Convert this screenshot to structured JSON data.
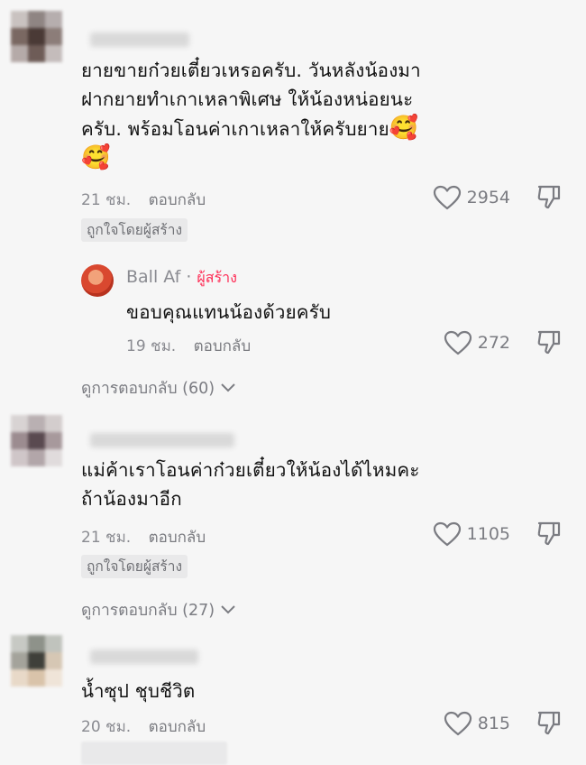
{
  "comments": [
    {
      "text_lines": [
        "ยายขายก๋วยเตี๋ยวเหรอครับ. วันหลังน้องมา",
        "ฝากยายทำเกาเหลาพิเศษ ให้น้องหน่อยนะ",
        "ครับ. พร้อมโอนค่าเกาเหลาให้ครับยาย"
      ],
      "emoji": "🥰",
      "time": "21 ชม.",
      "reply_label": "ตอบกลับ",
      "likes": "2954",
      "badge": "ถูกใจโดยผู้สร้าง",
      "reply": {
        "author": "Ball Af",
        "separator": " · ",
        "creator_label": "ผู้สร้าง",
        "text": "ขอบคุณแทนน้องด้วยครับ",
        "time": "19 ชม.",
        "reply_label": "ตอบกลับ",
        "likes": "272"
      },
      "view_replies": "ดูการตอบกลับ (60)"
    },
    {
      "text_lines": [
        "แม่ค้าเราโอนค่าก๋วยเตี๋ยวให้น้องได้ไหมคะ",
        "ถ้าน้องมาอีก"
      ],
      "time": "21 ชม.",
      "reply_label": "ตอบกลับ",
      "likes": "1105",
      "badge": "ถูกใจโดยผู้สร้าง",
      "view_replies": "ดูการตอบกลับ (27)"
    },
    {
      "text_lines": [
        "น้ำซุป ชุบชีวิต"
      ],
      "time": "20 ชม.",
      "reply_label": "ตอบกลับ",
      "likes": "815"
    }
  ],
  "icons": {
    "like": "heart-outline-icon",
    "dislike": "thumbs-down-icon",
    "expand": "chevron-down-icon"
  },
  "colors": {
    "creator": "#fe2c55",
    "secondary_text": "#8a8b91",
    "background": "#f6f6f6"
  }
}
